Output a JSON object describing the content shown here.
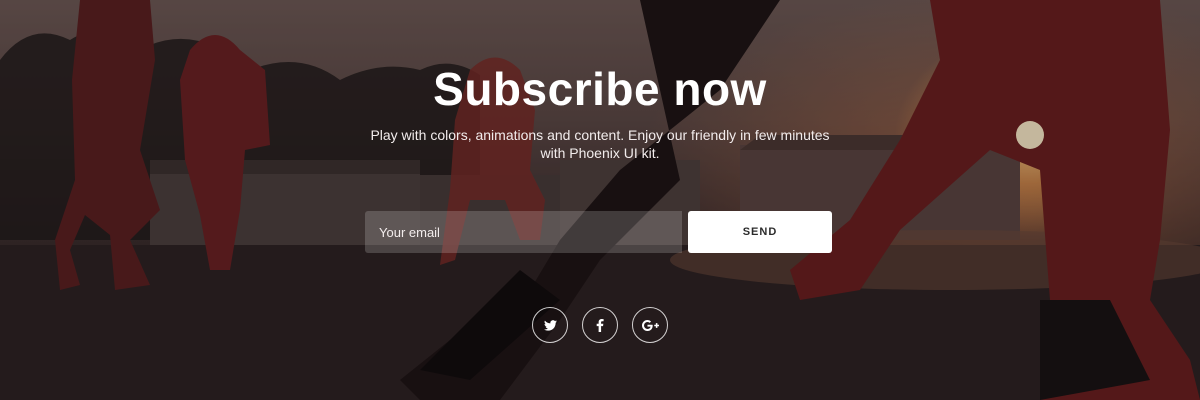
{
  "hero": {
    "title": "Subscribe now",
    "subtitle": "Play with colors, animations and content. Enjoy our friendly in few minutes with Phoenix UI kit."
  },
  "form": {
    "email_placeholder": "Your email",
    "send_label": "SEND"
  },
  "socials": [
    {
      "icon": "twitter-icon"
    },
    {
      "icon": "facebook-icon"
    },
    {
      "icon": "google-plus-icon"
    }
  ],
  "colors": {
    "button_bg": "#ffffff",
    "text": "#ffffff",
    "sun_glow": "#ffd68c"
  }
}
